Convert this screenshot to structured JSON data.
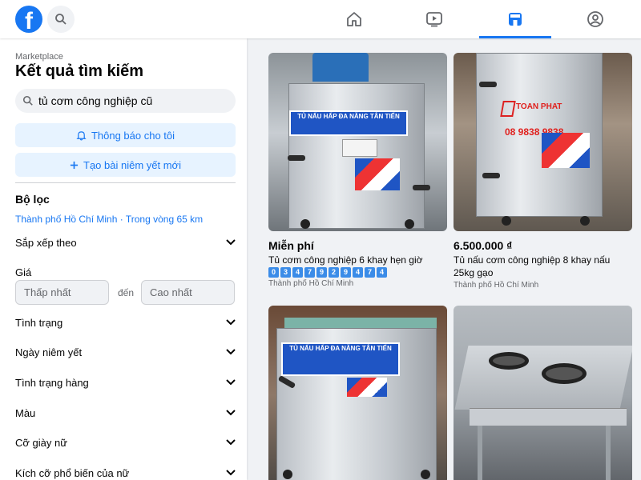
{
  "header": {
    "logo_letter": "f",
    "icons": [
      "search-icon",
      "home-icon",
      "video-icon",
      "marketplace-icon",
      "groups-icon"
    ],
    "accent": "#1877f2"
  },
  "sidebar": {
    "breadcrumb": "Marketplace",
    "title": "Kết quả tìm kiếm",
    "search_value": "tủ cơm công nghiệp cũ",
    "notify_label": "Thông báo cho tôi",
    "create_label": "Tạo bài niêm yết mới",
    "filters_heading": "Bộ lọc",
    "location": "Thành phố Hồ Chí Minh · Trong vòng 65 km",
    "sort_label": "Sắp xếp theo",
    "price_label": "Giá",
    "price_min_placeholder": "Thấp nhất",
    "price_to": "đến",
    "price_max_placeholder": "Cao nhất",
    "filters": [
      "Tình trạng",
      "Ngày niêm yết",
      "Tình trạng hàng",
      "Màu",
      "Cỡ giày nữ",
      "Kích cỡ phổ biến của nữ"
    ]
  },
  "listings": [
    {
      "price": "Miễn phí",
      "title": "Tủ cơm công nghiệp 6 khay hẹn giờ",
      "digits": [
        "0",
        "3",
        "4",
        "7",
        "9",
        "2",
        "9",
        "4",
        "7",
        "4"
      ],
      "location": "Thành phố Hồ Chí Minh",
      "sticker": "TỦ NẤU HẤP ĐA NĂNG TÂN TIẾN"
    },
    {
      "price": "6.500.000 ₫",
      "title": "Tủ nấu cơm công nghiệp 8 khay nấu 25kg gạo",
      "location": "Thành phố Hồ Chí Minh",
      "brand": "TOAN PHAT",
      "phone": "08 9838 9838"
    },
    {
      "sticker": "TỦ NẤU HẤP ĐA NĂNG TÂN TIẾN"
    },
    {}
  ]
}
